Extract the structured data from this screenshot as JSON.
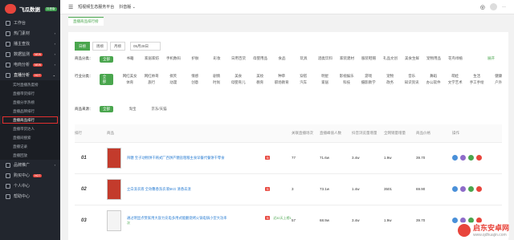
{
  "sidebar": {
    "brand": "飞瓜数据",
    "badge": "抖音版",
    "items": [
      {
        "label": "工作台"
      },
      {
        "label": "热门素材",
        "arrow": "›"
      },
      {
        "label": "播主查找",
        "arrow": "›"
      },
      {
        "label": "数据监测",
        "arrow": "›",
        "hot": "NEW"
      },
      {
        "label": "电商分析",
        "arrow": "›",
        "hot": "NEW"
      },
      {
        "label": "直播分析",
        "arrow": "⌄",
        "hot": "HOT"
      }
    ],
    "sub_items": [
      {
        "label": "实时直播热度榜"
      },
      {
        "label": "直播带货排行"
      },
      {
        "label": "直播分享热榜"
      },
      {
        "label": "直播品牌排行"
      },
      {
        "label": "直播商品排行",
        "active": true
      },
      {
        "label": "直播带货达人"
      },
      {
        "label": "直播间搜索"
      },
      {
        "label": "直播记录"
      },
      {
        "label": "直播回放"
      }
    ],
    "bottom_items": [
      {
        "label": "品牌推广",
        "arrow": "›"
      },
      {
        "label": "购买中心",
        "hot": "HOT"
      },
      {
        "label": "个人中心"
      },
      {
        "label": "帮助中心"
      }
    ]
  },
  "topbar": {
    "icon": "menu-icon",
    "title": "短视频生态服务平台",
    "version": "抖音版 ⌄",
    "user": "—"
  },
  "tab": {
    "label": "直播商品排行榜"
  },
  "filters": {
    "period_tabs": [
      {
        "label": "日榜",
        "active": true
      },
      {
        "label": "周榜"
      },
      {
        "label": "月榜"
      }
    ],
    "date": "05月28日",
    "category_label": "商品分类：",
    "category_all": "全部",
    "categories": [
      "书籍",
      "家居家纺",
      "手机数码",
      "护肤",
      "彩妆",
      "日用百货",
      "母婴用品",
      "食品",
      "玩具",
      "酒类饮料",
      "家装建材",
      "服装鞋帽",
      "礼品文创",
      "美食生鲜",
      "宠物用品",
      "花鸟绿植"
    ],
    "category_more": "展开",
    "industry_label": "行业分类：",
    "industry_all": "全部",
    "industries": [
      "网红美女",
      "网红帅哥",
      "搞笑",
      "情感",
      "剧情",
      "美食",
      "美妆",
      "种草",
      "穿搭",
      "明星",
      "影视娱乐",
      "游戏",
      "宠物",
      "音乐",
      "舞蹈",
      "萌娃",
      "生活",
      "健康",
      "体育",
      "旅行",
      "动漫",
      "创意",
      "时尚",
      "母婴育儿",
      "教育",
      "职场教育",
      "汽车",
      "家居",
      "科技",
      "摄影教学",
      "政务",
      "知识资讯",
      "办公软件",
      "文学艺术",
      "手工手绘",
      "户外"
    ],
    "source_label": "商品来源：",
    "source_all": "全部",
    "sources": [
      "淘宝",
      "京东/天猫"
    ]
  },
  "table": {
    "headers": [
      "排行",
      "商品",
      "",
      "关联直播场次",
      "直播峰值人数",
      "抖音浏览量增量",
      "全网销量增量",
      "商品价格",
      "操作"
    ],
    "rows": [
      {
        "rank": "01",
        "name": "拜糖 宝子动物饼干韩式厂西饼产糖盐粗粮主食早餐代餐饼干零食",
        "tag": "淘",
        "live": "77",
        "peak": "71.6w",
        "views": "3.4w",
        "sales": "1.9w",
        "price": "39.70"
      },
      {
        "rank": "02",
        "name": "立白洗衣液 全效馨香洗衣液5KG 清香去渍",
        "tag": "淘",
        "live": "3",
        "peak": "73.1w",
        "views": "1.4w",
        "sales": "3501",
        "price": "69.90"
      },
      {
        "rank": "03",
        "name": "通过明显点赞家用大容力充电多用式能翻烧烤火锅电锅小型大功率",
        "tag": "淘",
        "extra": "近30天上榜1次",
        "live": "57",
        "peak": "68.9w",
        "views": "3.4w",
        "sales": "1.9w",
        "price": "39.70"
      }
    ]
  },
  "watermark": {
    "title": "启东安卓网",
    "url": "www.qdhuajin.com"
  },
  "colors": {
    "accent": "#4aa64e",
    "sidebar_bg": "#22262e",
    "link": "#2d7fd3",
    "highlight": "#e23030"
  }
}
